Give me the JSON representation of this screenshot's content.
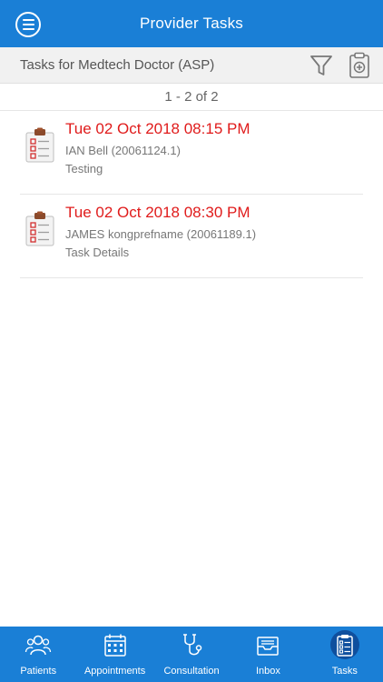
{
  "header": {
    "title": "Provider Tasks"
  },
  "subheader": {
    "title": "Tasks for Medtech Doctor (ASP)"
  },
  "pager": {
    "text": "1 - 2 of 2"
  },
  "tasks": [
    {
      "date": "Tue 02 Oct 2018 08:15 PM",
      "patient": "IAN Bell (20061124.1)",
      "description": "Testing"
    },
    {
      "date": "Tue 02 Oct 2018 08:30 PM",
      "patient": "JAMES kongprefname (20061189.1)",
      "description": "Task Details"
    }
  ],
  "nav": {
    "items": [
      {
        "label": "Patients",
        "icon": "patients-icon"
      },
      {
        "label": "Appointments",
        "icon": "calendar-icon"
      },
      {
        "label": "Consultation",
        "icon": "stethoscope-icon"
      },
      {
        "label": "Inbox",
        "icon": "inbox-icon"
      },
      {
        "label": "Tasks",
        "icon": "clipboard-checklist-icon"
      }
    ],
    "active": "Tasks"
  },
  "colors": {
    "primary": "#1a7fd6",
    "task_date": "#e01b1b",
    "nav_active_bg": "#0f4f9e"
  }
}
